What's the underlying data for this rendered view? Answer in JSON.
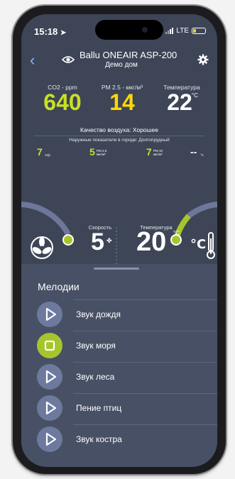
{
  "status": {
    "time": "15:18",
    "network": "LTE"
  },
  "header": {
    "title": "Ballu ONEAIR ASP-200",
    "subtitle": "Демо дом"
  },
  "metrics": {
    "co2": {
      "label": "CO2 - ppm",
      "value": "640",
      "color": "#c9e025"
    },
    "pm25": {
      "label": "PM 2.5 - мкг/м³",
      "value": "14",
      "color": "#ffd60a"
    },
    "temperature": {
      "label": "Температура",
      "value": "22",
      "unit": "°C"
    }
  },
  "air_quality": "Качество воздуха: Хорошее",
  "outdoor": {
    "title": "Наружные показатели в городе: Долгопрудный",
    "aqi": {
      "value": "7",
      "unit": "AQI"
    },
    "pm25": {
      "value": "5",
      "unit_line1": "PM 2.5",
      "unit_line2": "мкг/м³"
    },
    "pm10": {
      "value": "7",
      "unit_line1": "PM 10",
      "unit_line2": "мкг/м³"
    },
    "temp": {
      "value": "--",
      "unit": "°C"
    }
  },
  "controls": {
    "speed_label": "Скорость",
    "speed_value": "5",
    "temp_label": "Температура",
    "temp_value": "20",
    "temp_unit": "°C",
    "accent": "#a6c52c"
  },
  "melodies": {
    "title": "Мелодии",
    "items": [
      {
        "label": "Звук дождя",
        "state": "play"
      },
      {
        "label": "Звук моря",
        "state": "stop"
      },
      {
        "label": "Звук леса",
        "state": "play"
      },
      {
        "label": "Пение птиц",
        "state": "play"
      },
      {
        "label": "Звук костра",
        "state": "play"
      }
    ]
  }
}
